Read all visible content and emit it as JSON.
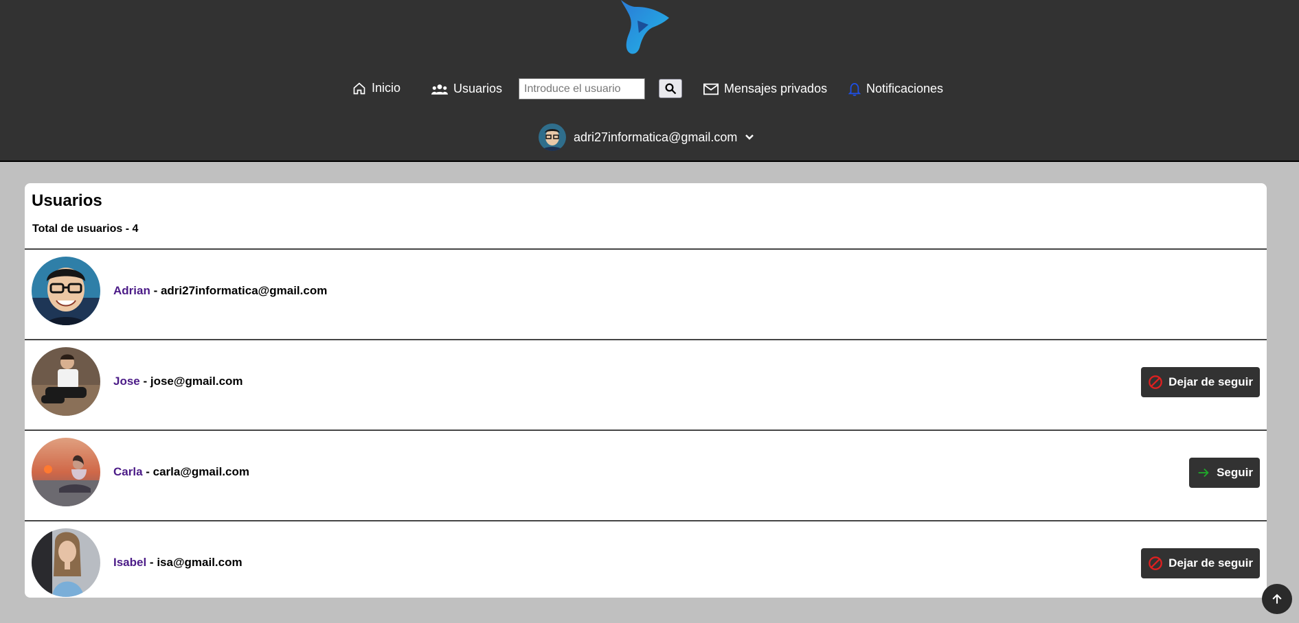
{
  "nav": {
    "inicio": "Inicio",
    "usuarios": "Usuarios",
    "search_placeholder": "Introduce el usuario",
    "mensajes": "Mensajes privados",
    "notificaciones": "Notificaciones",
    "current_user": "adri27informatica@gmail.com"
  },
  "icons": {
    "logo": "logo-icon",
    "home": "home-icon",
    "users": "users-icon",
    "search": "search-icon",
    "mail": "mail-icon",
    "bell": "bell-icon",
    "chevron": "chevron-down-icon",
    "unfollow": "ban-icon",
    "follow": "arrow-right-icon",
    "scroll_top": "arrow-up-icon"
  },
  "colors": {
    "header_bg": "#323232",
    "page_bg": "#c0c0c0",
    "username": "#4b1b87",
    "bell": "#1e50e6",
    "unfollow_icon": "#e02020",
    "follow_icon": "#1faa2a"
  },
  "main": {
    "title": "Usuarios",
    "total": "Total de usuarios - 4",
    "users": [
      {
        "name": "Adrian",
        "sep": " - ",
        "email": "adri27informatica@gmail.com",
        "action": null
      },
      {
        "name": "Jose",
        "sep": " - ",
        "email": "jose@gmail.com",
        "action": "Dejar de seguir"
      },
      {
        "name": "Carla",
        "sep": " - ",
        "email": "carla@gmail.com",
        "action": "Seguir"
      },
      {
        "name": "Isabel",
        "sep": " - ",
        "email": "isa@gmail.com",
        "action": "Dejar de seguir"
      }
    ]
  }
}
